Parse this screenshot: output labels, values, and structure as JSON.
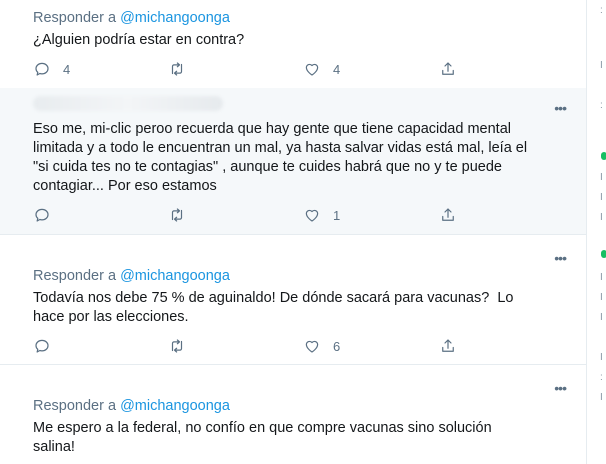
{
  "tweets": [
    {
      "reply_prefix": "Responder a",
      "reply_handle": "@michangoonga",
      "text": "¿Alguien podría estar en contra?",
      "actions": {
        "reply_count": "4",
        "retweet_count": "",
        "like_count": "4"
      }
    },
    {
      "text": "Eso me, mi-clic peroo recuerda que hay gente que tiene capacidad mental\nlimitada y a todo le encuentran un mal, ya hasta salvar vidas está mal, leía el\n\"si cuida tes no te contagias\" , aunque te cuides habrá que no y te puede\ncontagiar... Por eso estamos",
      "actions": {
        "reply_count": "",
        "retweet_count": "",
        "like_count": "1"
      }
    },
    {
      "reply_prefix": "Responder a",
      "reply_handle": "@michangoonga",
      "text": "Todavía nos debe 75 % de aguinaldo! De dónde sacará para vacunas?  Lo\nhace por las elecciones.",
      "actions": {
        "reply_count": "",
        "retweet_count": "",
        "like_count": "6"
      }
    },
    {
      "reply_prefix": "Responder a",
      "reply_handle": "@michangoonga",
      "text": "Me espero a la federal, no confío en que compre vacunas sino solución\nsalina!"
    }
  ],
  "icons": {
    "more": "more-horizontal-icon",
    "reply": "reply-bubble-icon",
    "retweet": "retweet-arrows-icon",
    "like": "heart-icon",
    "share": "share-upload-icon"
  },
  "colors": {
    "mention": "#1b95e0",
    "secondary_text": "#5b7083",
    "highlight_bg": "#f5f8fa",
    "divider": "#e6ecf0",
    "status_green": "#17bf63"
  }
}
